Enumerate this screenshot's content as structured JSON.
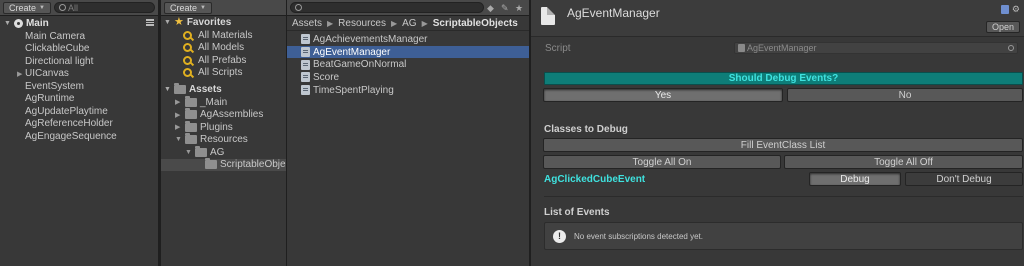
{
  "hierarchy": {
    "create_label": "Create",
    "search_placeholder": "All",
    "scene_name": "Main",
    "items": [
      {
        "label": "Main Camera"
      },
      {
        "label": "ClickableCube"
      },
      {
        "label": "Directional light"
      },
      {
        "label": "UICanvas",
        "expandable": true
      },
      {
        "label": "EventSystem"
      },
      {
        "label": "AgRuntime"
      },
      {
        "label": "AgUpdatePlaytime"
      },
      {
        "label": "AgReferenceHolder"
      },
      {
        "label": "AgEngageSequence"
      }
    ]
  },
  "project": {
    "create_label": "Create",
    "search_value": "",
    "favorites": {
      "title": "Favorites",
      "items": [
        "All Materials",
        "All Models",
        "All Prefabs",
        "All Scripts"
      ]
    },
    "assets": {
      "title": "Assets",
      "items": [
        "_Main",
        "AgAssemblies",
        "Plugins",
        "Resources",
        "AG",
        "ScriptableObje"
      ]
    },
    "breadcrumb": [
      "Assets",
      "Resources",
      "AG",
      "ScriptableObjects"
    ],
    "files": [
      {
        "label": "AgAchievementsManager",
        "selected": false
      },
      {
        "label": "AgEventManager",
        "selected": true
      },
      {
        "label": "BeatGameOnNormal",
        "selected": false
      },
      {
        "label": "Score",
        "selected": false
      },
      {
        "label": "TimeSpentPlaying",
        "selected": false
      }
    ]
  },
  "inspector": {
    "title": "AgEventManager",
    "open_label": "Open",
    "script_label": "Script",
    "script_value": "AgEventManager",
    "debug_question": "Should Debug Events?",
    "yes_label": "Yes",
    "no_label": "No",
    "classes_title": "Classes to Debug",
    "fill_label": "Fill EventClass List",
    "toggle_on_label": "Toggle All On",
    "toggle_off_label": "Toggle All Off",
    "class_name": "AgClickedCubeEvent",
    "debug_label": "Debug",
    "dont_debug_label": "Don't Debug",
    "events_title": "List of Events",
    "info_text": "No event subscriptions detected yet.",
    "colors": {
      "accent_teal": "#0e7d78",
      "label_cyan": "#3fe2df",
      "selection_blue": "#3e5f96"
    }
  }
}
